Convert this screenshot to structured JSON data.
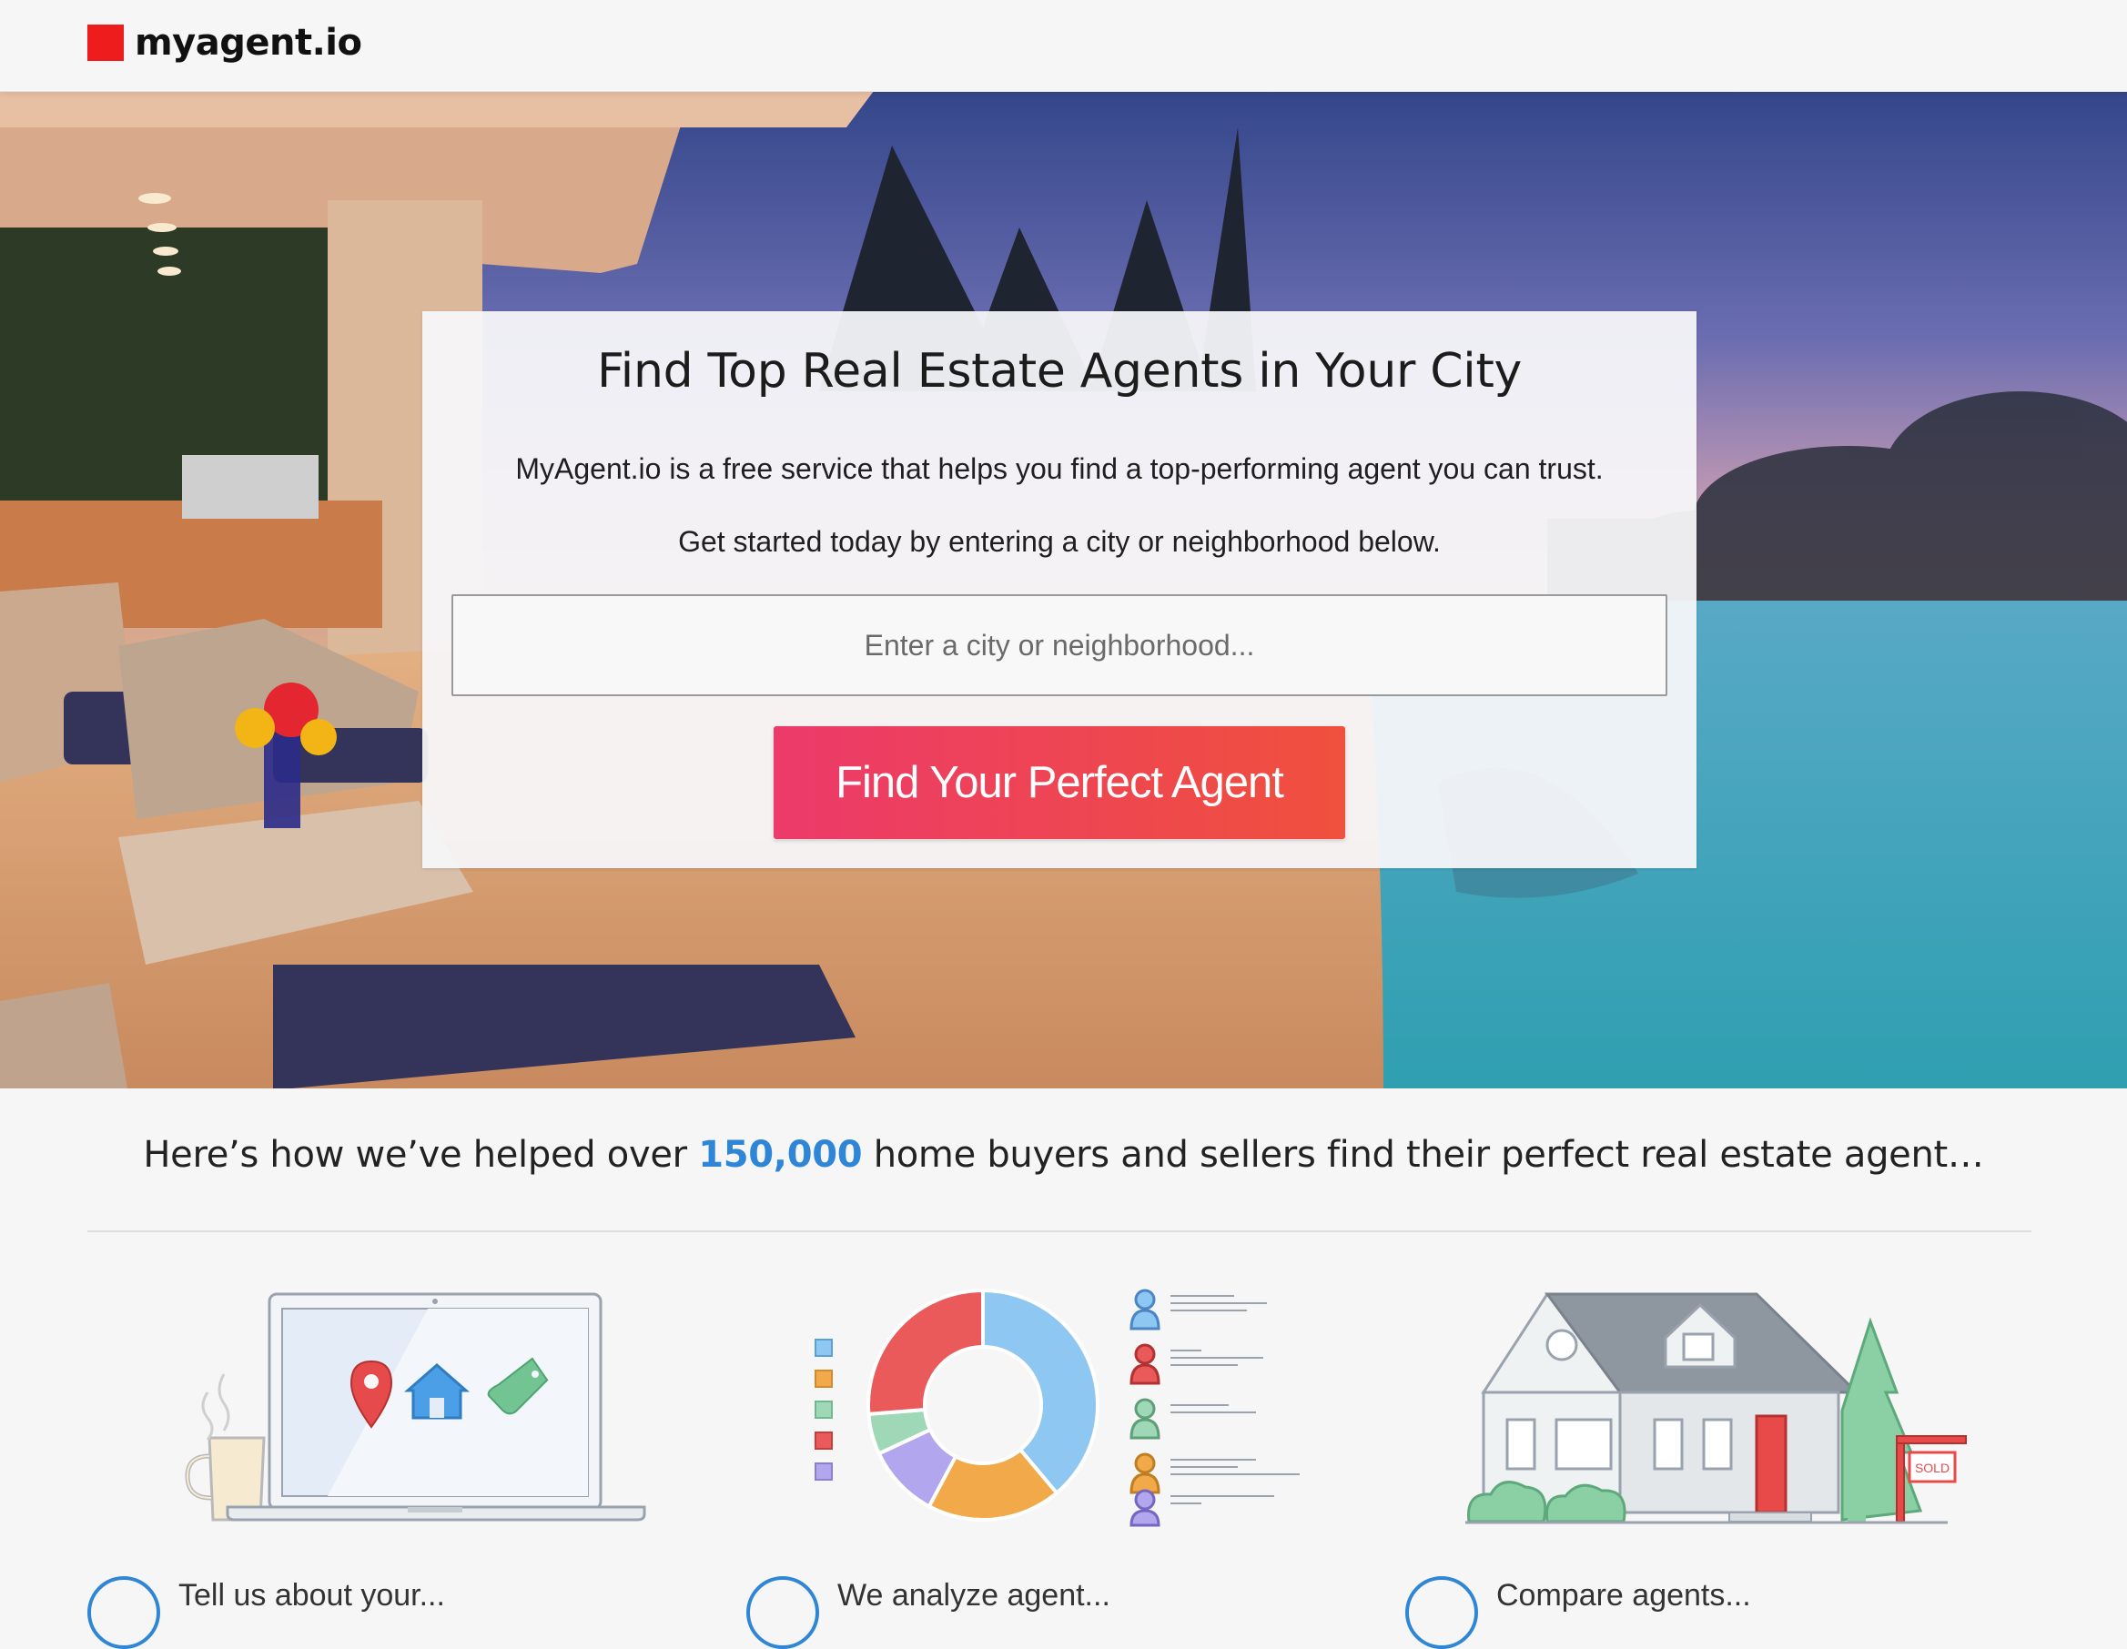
{
  "header": {
    "logo_text": "myagent.io",
    "logo_color": "#ee1c1c"
  },
  "hero": {
    "title": "Find Top Real Estate Agents in Your City",
    "description": "MyAgent.io is a free service that helps you find a top-performing agent you can trust.",
    "subtitle": "Get started today by entering a city or neighborhood below.",
    "search": {
      "placeholder": "Enter a city or neighborhood...",
      "value": ""
    },
    "cta_label": "Find Your Perfect Agent",
    "cta_gradient": [
      "#ec3a6a",
      "#f0503d"
    ]
  },
  "tagline": {
    "before": "Here’s how we’ve helped over ",
    "highlight": "150,000",
    "after": " home buyers and sellers find their perfect real estate agent…",
    "highlight_color": "#2f86d7"
  },
  "features": [
    {
      "illustration": "laptop-with-map-pin-house-tag-and-coffee-mug",
      "text": "Tell us about your..."
    },
    {
      "illustration": "donut-chart-with-agent-list",
      "text": "We analyze agent..."
    },
    {
      "illustration": "house-with-sold-sign",
      "text": "Compare agents..."
    }
  ],
  "sold_sign_label": "SOLD"
}
